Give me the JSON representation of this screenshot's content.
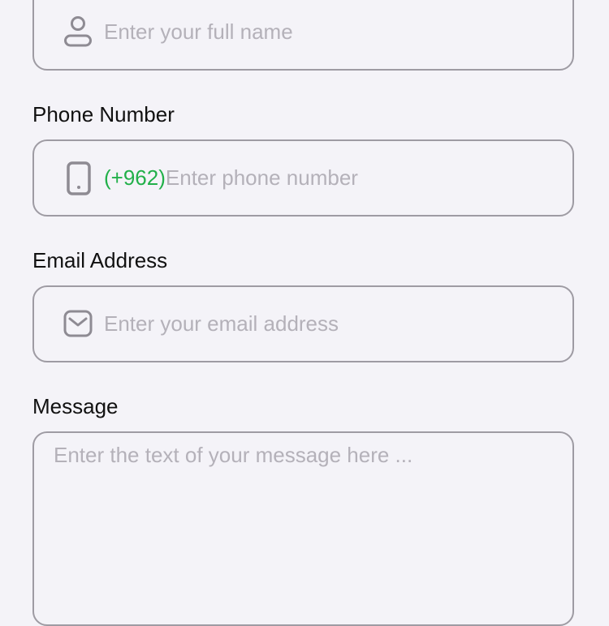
{
  "form": {
    "name": {
      "placeholder": "Enter your full name",
      "icon": "user-icon"
    },
    "phone": {
      "label": "Phone Number",
      "prefix": "(+962)",
      "placeholder": "Enter phone number",
      "icon": "phone-icon"
    },
    "email": {
      "label": "Email Address",
      "placeholder": "Enter your email address",
      "icon": "mail-icon"
    },
    "message": {
      "label": "Message",
      "placeholder": "Enter the text of your message here ..."
    }
  },
  "colors": {
    "background": "#f4f3f8",
    "border": "#9e9ba3",
    "placeholder": "#b4b1b9",
    "prefix": "#22b04a",
    "label": "#111111",
    "icon": "#8e8b93"
  }
}
